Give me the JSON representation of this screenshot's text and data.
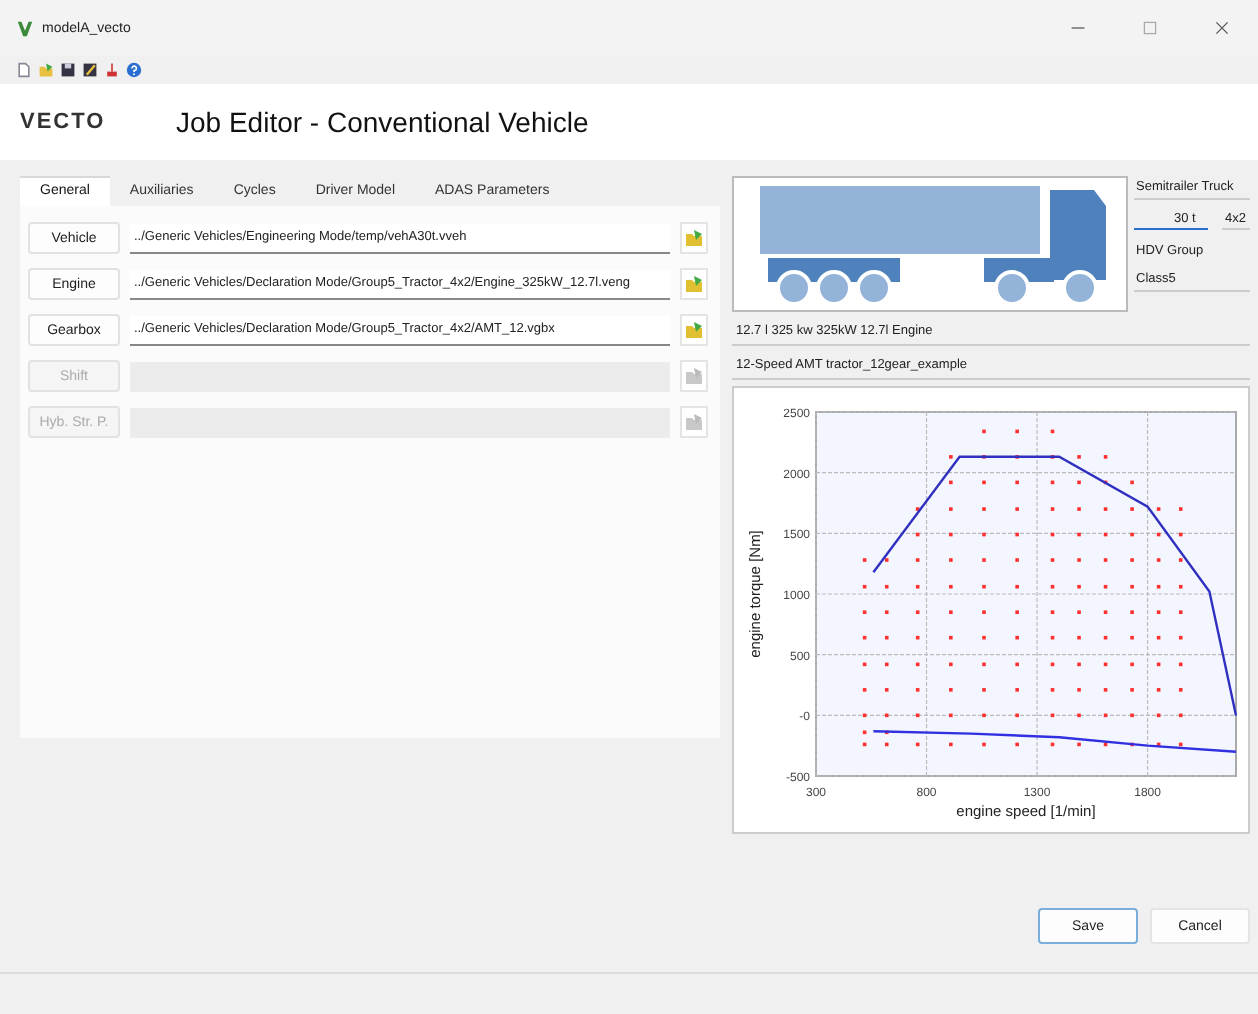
{
  "window": {
    "title": "modelA_vecto"
  },
  "header": {
    "logo": "VECTO",
    "title": "Job Editor - Conventional Vehicle"
  },
  "tabs": [
    {
      "label": "General",
      "selected": true
    },
    {
      "label": "Auxiliaries",
      "selected": false
    },
    {
      "label": "Cycles",
      "selected": false
    },
    {
      "label": "Driver Model",
      "selected": false
    },
    {
      "label": "ADAS Parameters",
      "selected": false
    }
  ],
  "files": [
    {
      "label": "Vehicle",
      "value": "../Generic Vehicles/Engineering Mode/temp/vehA30t.vveh",
      "disabled": false
    },
    {
      "label": "Engine",
      "value": "../Generic Vehicles/Declaration Mode/Group5_Tractor_4x2/Engine_325kW_12.7l.veng",
      "disabled": false
    },
    {
      "label": "Gearbox",
      "value": "../Generic Vehicles/Declaration Mode/Group5_Tractor_4x2/AMT_12.vgbx",
      "disabled": false
    },
    {
      "label": "Shift",
      "disabled": true
    },
    {
      "label": "Hyb. Str. P.",
      "disabled": true
    }
  ],
  "vehicle": {
    "type": "Semitrailer Truck",
    "mass": "30 t",
    "axle": "4x2",
    "group_label": "HDV Group",
    "group": "Class5"
  },
  "engine_info": "12.7 l 325 kw 325kW 12.7l Engine",
  "gearbox_info": "12-Speed AMT tractor_12gear_example",
  "chart_data": {
    "type": "scatter",
    "xlabel": "engine speed [1/min]",
    "ylabel": "engine torque [Nm]",
    "xlim": [
      300,
      2200
    ],
    "ylim": [
      -500,
      2500
    ],
    "grid": true,
    "xticks": [
      300,
      800,
      1300,
      1800
    ],
    "yticks": [
      -500,
      {
        "value": 0,
        "label": "-0"
      },
      500,
      1000,
      1500,
      2000,
      2500
    ],
    "series": [
      {
        "color": "#ff3030",
        "x": [
          520,
          520,
          520,
          520,
          520,
          520,
          520,
          520,
          520,
          620,
          620,
          620,
          620,
          620,
          620,
          620,
          620,
          620,
          760,
          760,
          760,
          760,
          760,
          760,
          760,
          760,
          760,
          760,
          910,
          910,
          910,
          910,
          910,
          910,
          910,
          910,
          910,
          910,
          910,
          910,
          1060,
          1060,
          1060,
          1060,
          1060,
          1060,
          1060,
          1060,
          1060,
          1060,
          1060,
          1060,
          1060,
          1210,
          1210,
          1210,
          1210,
          1210,
          1210,
          1210,
          1210,
          1210,
          1210,
          1210,
          1210,
          1210,
          1370,
          1370,
          1370,
          1370,
          1370,
          1370,
          1370,
          1370,
          1370,
          1370,
          1370,
          1370,
          1370,
          1490,
          1490,
          1490,
          1490,
          1490,
          1490,
          1490,
          1490,
          1490,
          1490,
          1490,
          1490,
          1610,
          1610,
          1610,
          1610,
          1610,
          1610,
          1610,
          1610,
          1610,
          1610,
          1610,
          1610,
          1730,
          1730,
          1730,
          1730,
          1730,
          1730,
          1730,
          1730,
          1730,
          1730,
          1730,
          1850,
          1850,
          1850,
          1850,
          1850,
          1850,
          1850,
          1850,
          1850,
          1850,
          1950,
          1950,
          1950,
          1950,
          1950,
          1950,
          1950,
          1950,
          1950,
          1950
        ],
        "values": [
          -240,
          -140,
          0,
          210,
          420,
          640,
          850,
          1060,
          1280,
          -240,
          -140,
          0,
          210,
          420,
          640,
          850,
          1060,
          1280,
          -240,
          0,
          210,
          420,
          640,
          850,
          1060,
          1280,
          1490,
          1700,
          -240,
          0,
          210,
          420,
          640,
          850,
          1060,
          1280,
          1490,
          1700,
          1920,
          2130,
          -240,
          0,
          210,
          420,
          640,
          850,
          1060,
          1280,
          1490,
          1700,
          1920,
          2130,
          2340,
          -240,
          0,
          210,
          420,
          640,
          850,
          1060,
          1280,
          1490,
          1700,
          1920,
          2130,
          2340,
          -240,
          0,
          210,
          420,
          640,
          850,
          1060,
          1280,
          1490,
          1700,
          1920,
          2130,
          2340,
          -240,
          0,
          210,
          420,
          640,
          850,
          1060,
          1280,
          1490,
          1700,
          1920,
          2130,
          -240,
          0,
          210,
          420,
          640,
          850,
          1060,
          1280,
          1490,
          1700,
          1920,
          2130,
          -240,
          0,
          210,
          420,
          640,
          850,
          1060,
          1280,
          1490,
          1700,
          1920,
          -240,
          0,
          210,
          420,
          640,
          850,
          1060,
          1280,
          1490,
          1700,
          -240,
          0,
          210,
          420,
          640,
          850,
          1060,
          1280,
          1490,
          1700
        ]
      },
      {
        "type": "line",
        "color": "#3030c0",
        "x": [
          560,
          950,
          1400,
          1800,
          2080,
          2200
        ],
        "values": [
          1180,
          2130,
          2130,
          1720,
          1020,
          0
        ]
      },
      {
        "type": "line",
        "color": "#3030e0",
        "x": [
          560,
          1000,
          1400,
          1800,
          2200
        ],
        "values": [
          -130,
          -150,
          -180,
          -250,
          -300
        ]
      }
    ]
  },
  "buttons": [
    {
      "label": "Save",
      "kind": "default"
    },
    {
      "label": "Cancel",
      "kind": "normal"
    }
  ]
}
